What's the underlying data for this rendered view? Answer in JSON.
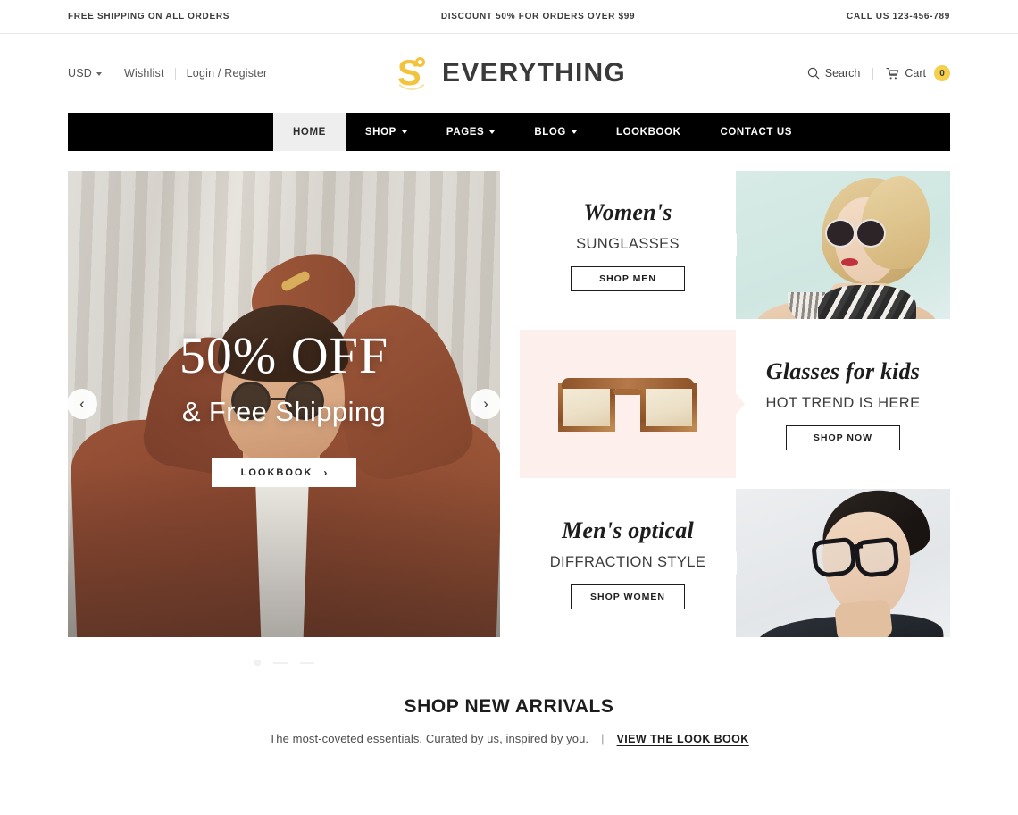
{
  "topbar": {
    "left": "FREE SHIPPING ON ALL ORDERS",
    "center": "DISCOUNT 50% FOR ORDERS OVER $99",
    "right": "CALL US 123-456-789"
  },
  "header": {
    "currency": "USD",
    "wishlist": "Wishlist",
    "account": "Login / Register",
    "logo_mark": "S",
    "logo_text": "EVERYTHING",
    "search": "Search",
    "cart": "Cart",
    "cart_count": "0",
    "accent_color": "#f2c33c",
    "badge_color": "#f5cf4e"
  },
  "nav": {
    "items": [
      {
        "label": "HOME",
        "has_caret": false,
        "active": true
      },
      {
        "label": "SHOP",
        "has_caret": true,
        "active": false
      },
      {
        "label": "PAGES",
        "has_caret": true,
        "active": false
      },
      {
        "label": "BLOG",
        "has_caret": true,
        "active": false
      },
      {
        "label": "LOOKBOOK",
        "has_caret": false,
        "active": false
      },
      {
        "label": "CONTACT US",
        "has_caret": false,
        "active": false
      }
    ]
  },
  "hero": {
    "headline": "50% OFF",
    "subheadline": "& Free Shipping",
    "button": "LOOKBOOK",
    "button_chevron": "›",
    "prev_arrow": "‹",
    "next_arrow": "›",
    "slide_count": 3,
    "active_slide": 1
  },
  "promos": [
    {
      "title": "Women's",
      "subtitle": "SUNGLASSES",
      "button": "SHOP MEN",
      "image_alt": "woman-wearing-sunglasses",
      "background": "#ffffff"
    },
    {
      "title": "Glasses for kids",
      "subtitle": "HOT TREND IS HERE",
      "button": "SHOP NOW",
      "image_alt": "tortoiseshell-sunglasses-product",
      "background": "#fdf0ec"
    },
    {
      "title": "Men's optical",
      "subtitle": "DIFFRACTION STYLE",
      "button": "SHOP WOMEN",
      "image_alt": "man-wearing-eyeglasses",
      "background": "#ffffff"
    }
  ],
  "arrivals": {
    "title": "SHOP NEW ARRIVALS",
    "subtitle": "The most-coveted essentials. Curated by us, inspired by you.",
    "separator": "|",
    "link": "VIEW THE LOOK BOOK"
  }
}
